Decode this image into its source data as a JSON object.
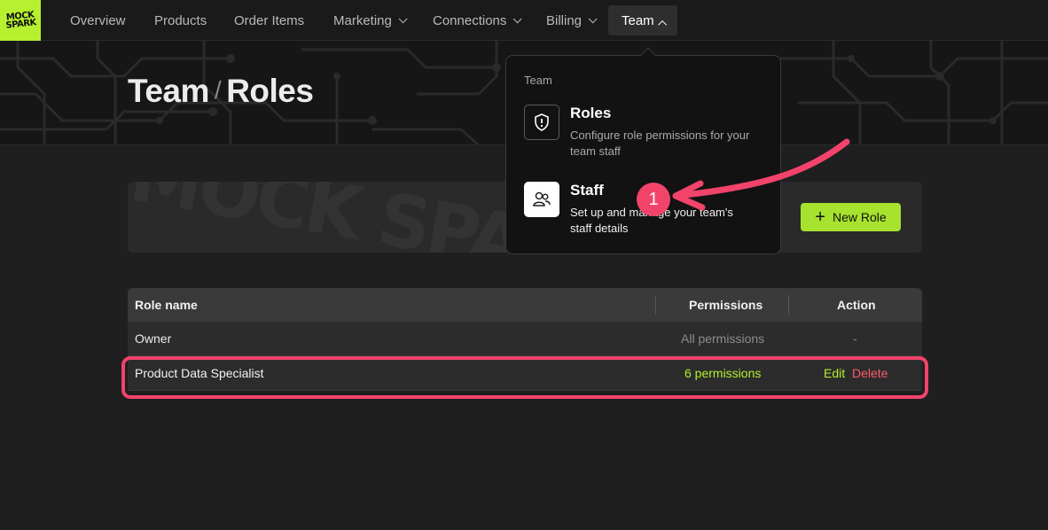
{
  "brand": {
    "logo_text": "MOCK SPARK",
    "accent": "#b6f02e"
  },
  "nav": {
    "items": [
      {
        "label": "Overview",
        "has_dropdown": false
      },
      {
        "label": "Products",
        "has_dropdown": false
      },
      {
        "label": "Order Items",
        "has_dropdown": false
      },
      {
        "label": "Marketing",
        "has_dropdown": true
      },
      {
        "label": "Connections",
        "has_dropdown": true
      },
      {
        "label": "Billing",
        "has_dropdown": true
      },
      {
        "label": "Team",
        "has_dropdown": true,
        "active": true
      }
    ]
  },
  "page": {
    "section": "Team",
    "separator": "/",
    "title": "Roles"
  },
  "toolbar": {
    "new_role_label": "New Role",
    "watermark": "MOCK SPARK"
  },
  "table": {
    "headers": {
      "role_name": "Role name",
      "permissions": "Permissions",
      "action": "Action"
    },
    "rows": [
      {
        "role_name": "Owner",
        "permissions": "All permissions",
        "action": "-"
      },
      {
        "role_name": "Product Data Specialist",
        "permissions": "6 permissions",
        "edit": "Edit",
        "delete": "Delete"
      }
    ]
  },
  "dropdown": {
    "header": "Team",
    "items": [
      {
        "title": "Roles",
        "description": "Configure role permissions for your team staff",
        "icon": "shield-icon"
      },
      {
        "title": "Staff",
        "description": "Set up and manage your team's staff details",
        "icon": "users-icon"
      }
    ]
  },
  "annotation": {
    "step": "1",
    "color": "#f2436a"
  }
}
